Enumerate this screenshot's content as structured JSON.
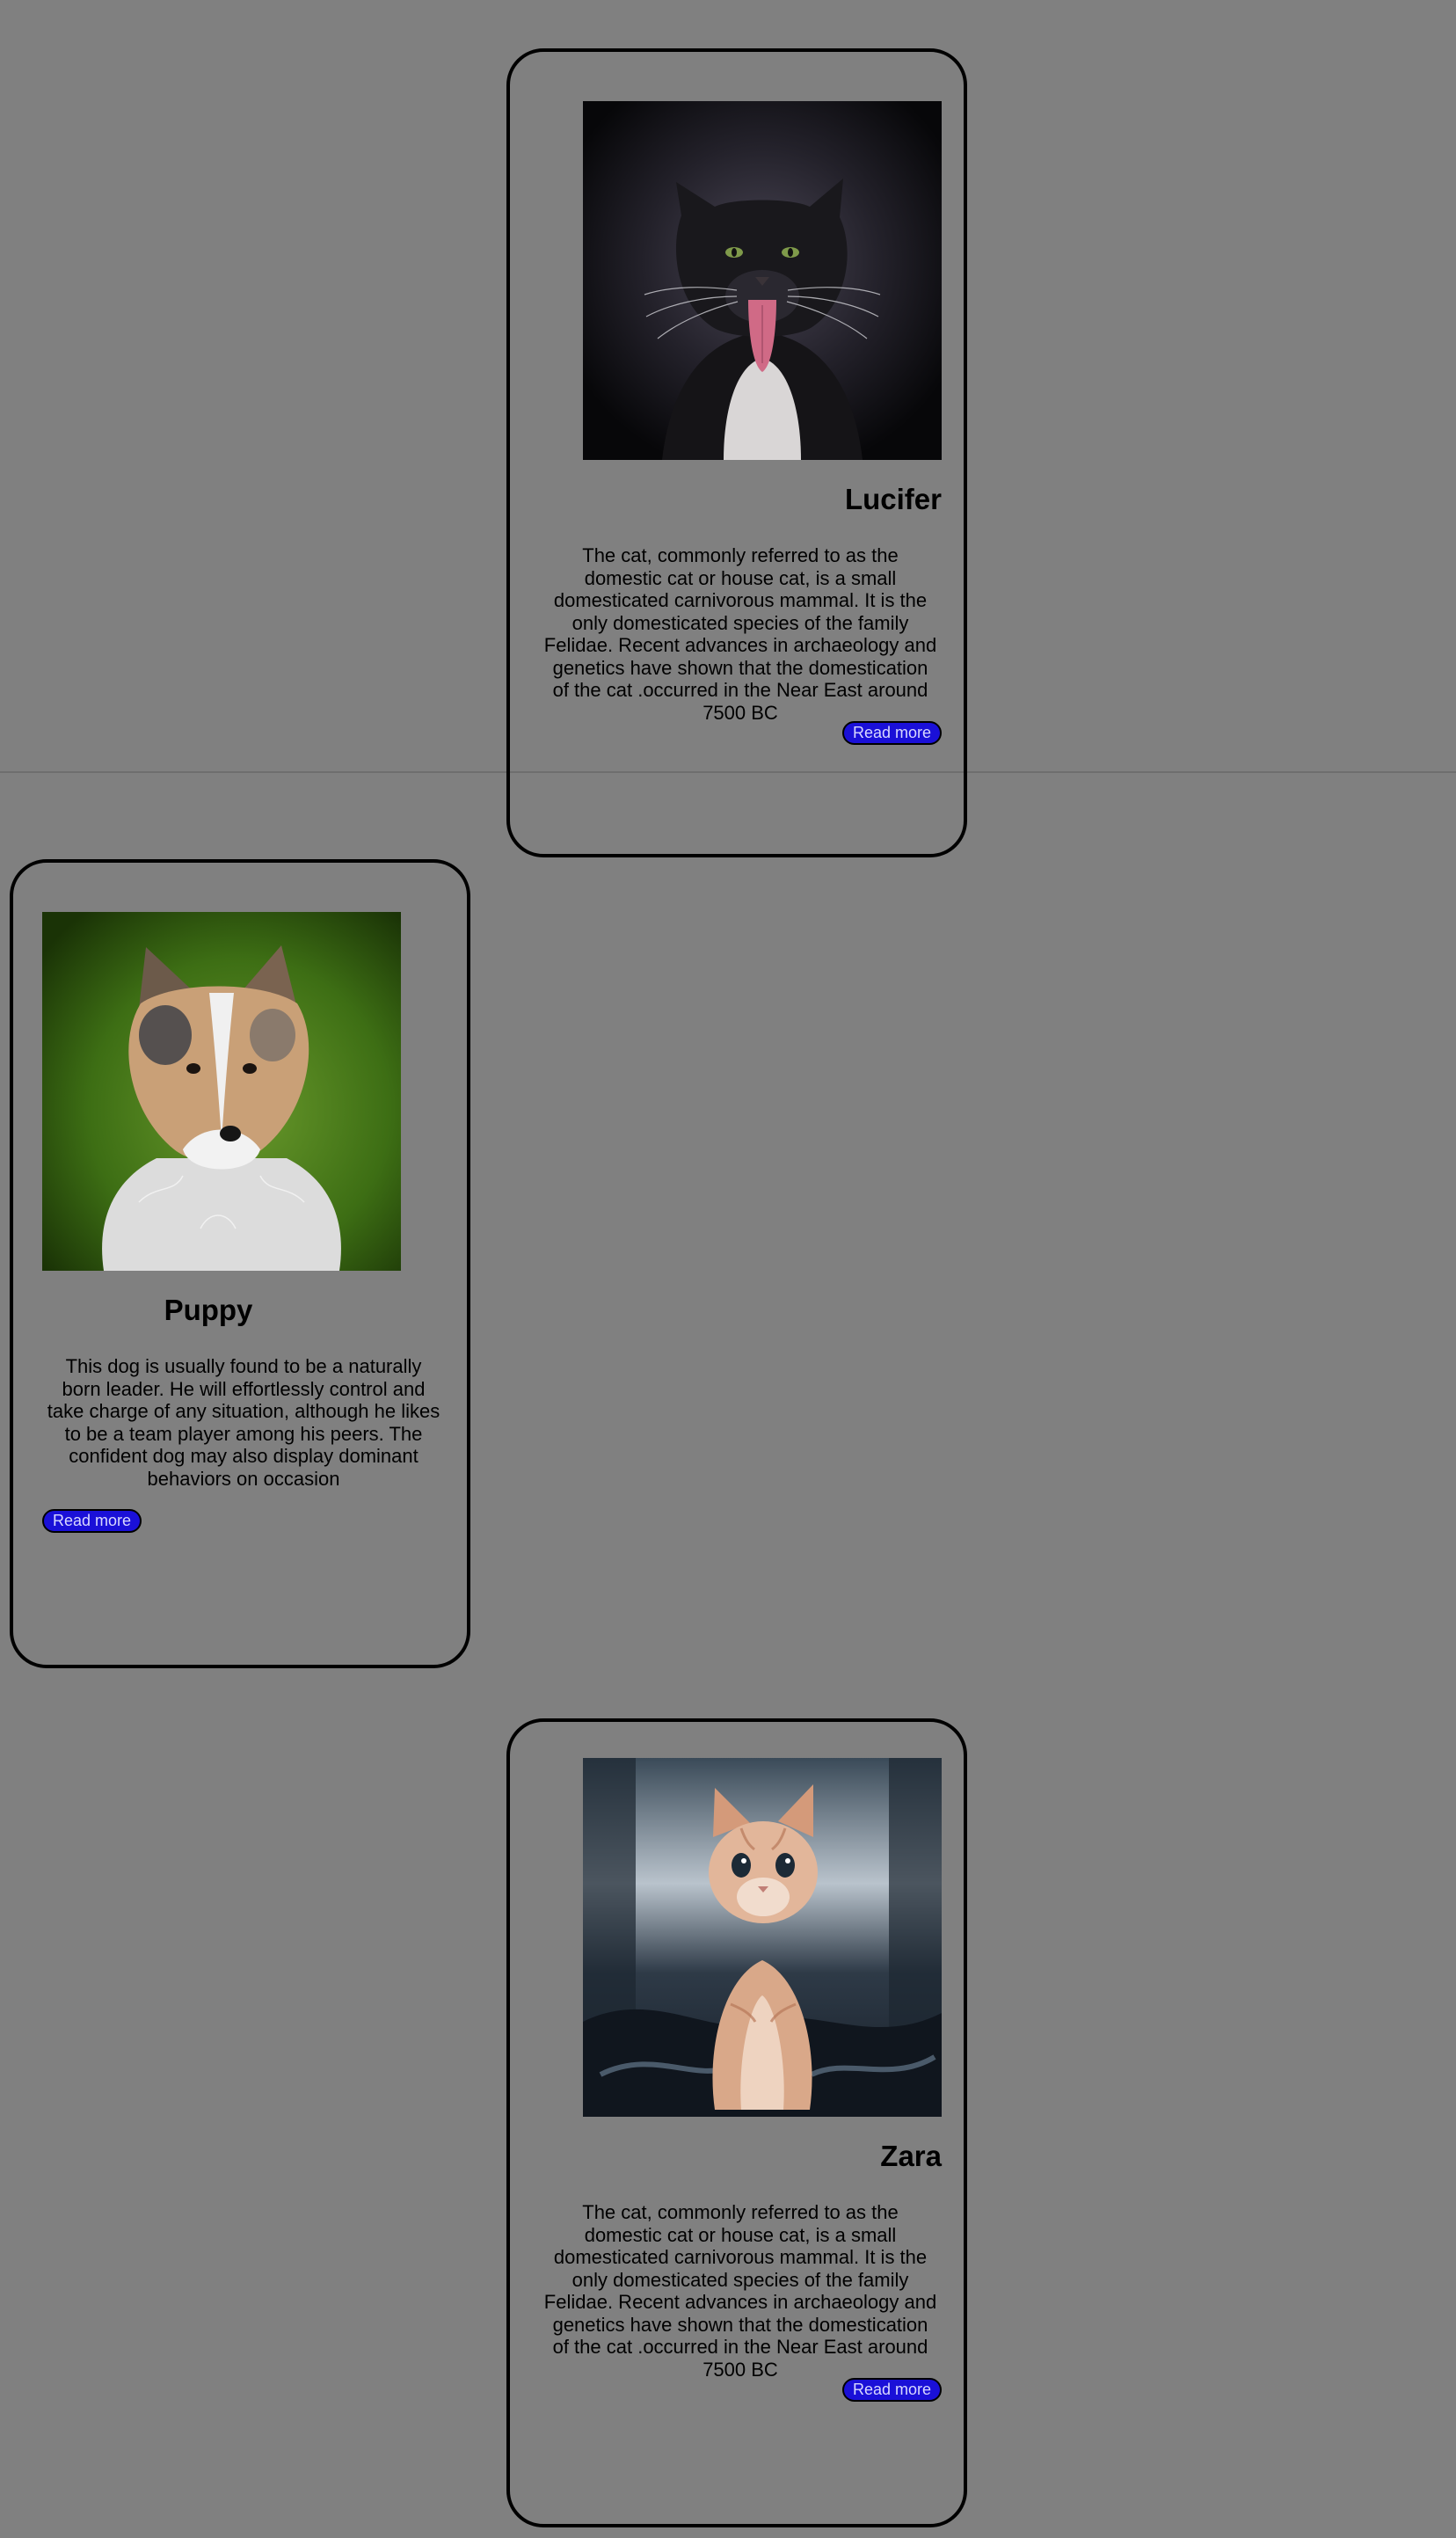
{
  "cards": [
    {
      "name": "Lucifer",
      "description": "The cat, commonly referred to as the domestic cat or house cat, is a small domesticated carnivorous mammal. It is the only domesticated species of the family Felidae. Recent advances in archaeology and genetics have shown that the domestication of the cat .occurred in the Near East around 7500 BC",
      "button_label": "Read more",
      "image": "black-and-white-cat-tongue-out-photo"
    },
    {
      "name": "Puppy",
      "description": "This dog is usually found to be a naturally born leader. He will effortlessly control and take charge of any situation, although he likes to be a team player among his peers. The confident dog may also display dominant behaviors on occasion",
      "button_label": "Read more",
      "image": "sheltie-puppy-photo"
    },
    {
      "name": "Zara",
      "description": "The cat, commonly referred to as the domestic cat or house cat, is a small domesticated carnivorous mammal. It is the only domesticated species of the family Felidae. Recent advances in archaeology and genetics have shown that the domestication of the cat .occurred in the Near East around 7500 BC",
      "button_label": "Read more",
      "image": "ginger-kitten-photo"
    }
  ],
  "colors": {
    "page_background": "#808080",
    "button_background": "#1a10d8",
    "button_text": "#d8d8ff",
    "card_border": "#000000"
  }
}
